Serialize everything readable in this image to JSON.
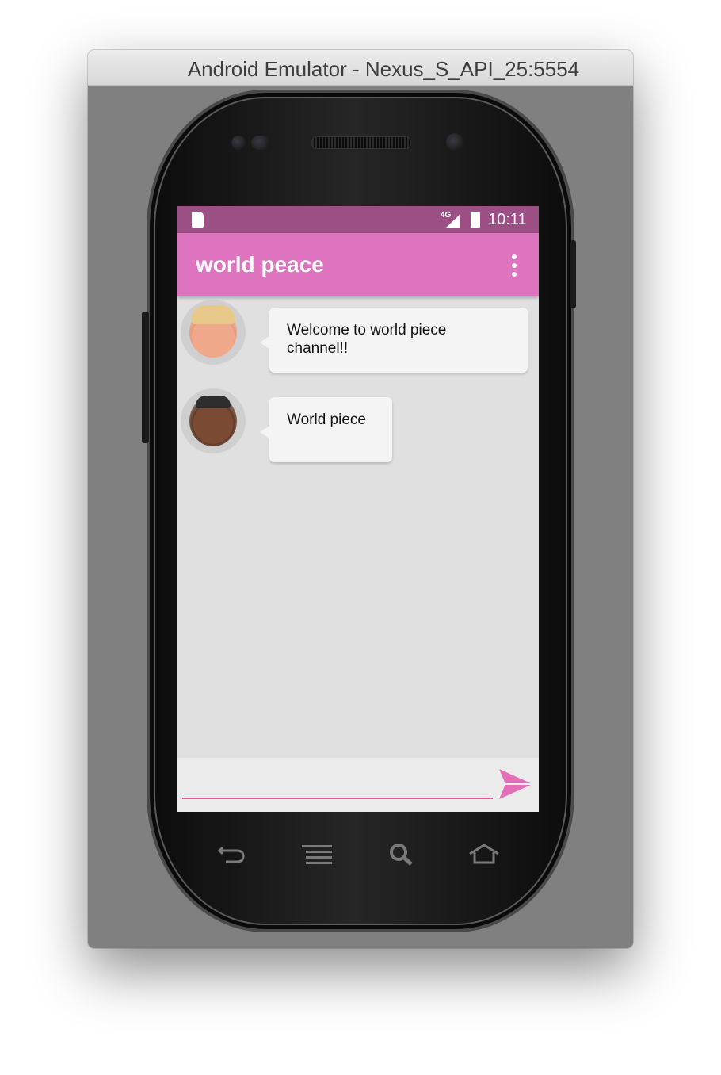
{
  "window": {
    "title": "Android Emulator - Nexus_S_API_25:5554"
  },
  "status_bar": {
    "network": "4G",
    "time": "10:11"
  },
  "app_bar": {
    "title": "world peace"
  },
  "messages": [
    {
      "avatar": "avatar-trump",
      "text": "Welcome to world piece channel!!"
    },
    {
      "avatar": "avatar-obama",
      "text": "World piece"
    }
  ],
  "composer": {
    "value": "",
    "placeholder": ""
  },
  "colors": {
    "app_bar": "#de74c0",
    "status_bar": "#9b4f85",
    "accent": "#e8559c",
    "send_icon": "#e36fb8"
  },
  "nav_keys": [
    "back-icon",
    "menu-icon",
    "search-icon",
    "home-icon"
  ]
}
